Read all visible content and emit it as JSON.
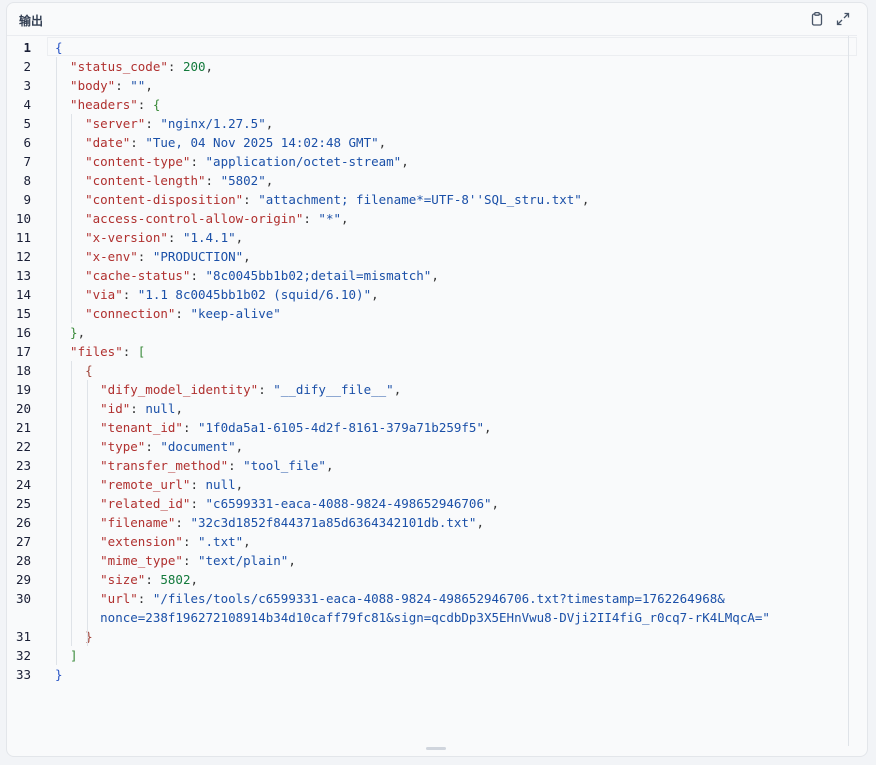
{
  "panel": {
    "title": "输出",
    "copy_icon": "clipboard-icon",
    "expand_icon": "expand-icon"
  },
  "lines": [
    [
      [
        "br1",
        "{"
      ]
    ],
    [
      [
        "key",
        "  \"status_code\""
      ],
      [
        "p",
        ": "
      ],
      [
        "num",
        "200"
      ],
      [
        "p",
        ","
      ]
    ],
    [
      [
        "key",
        "  \"body\""
      ],
      [
        "p",
        ": "
      ],
      [
        "str",
        "\"\""
      ],
      [
        "p",
        ","
      ]
    ],
    [
      [
        "key",
        "  \"headers\""
      ],
      [
        "p",
        ": "
      ],
      [
        "br2",
        "{"
      ]
    ],
    [
      [
        "key",
        "    \"server\""
      ],
      [
        "p",
        ": "
      ],
      [
        "str",
        "\"nginx/1.27.5\""
      ],
      [
        "p",
        ","
      ]
    ],
    [
      [
        "key",
        "    \"date\""
      ],
      [
        "p",
        ": "
      ],
      [
        "str",
        "\"Tue, 04 Nov 2025 14:02:48 GMT\""
      ],
      [
        "p",
        ","
      ]
    ],
    [
      [
        "key",
        "    \"content-type\""
      ],
      [
        "p",
        ": "
      ],
      [
        "str",
        "\"application/octet-stream\""
      ],
      [
        "p",
        ","
      ]
    ],
    [
      [
        "key",
        "    \"content-length\""
      ],
      [
        "p",
        ": "
      ],
      [
        "str",
        "\"5802\""
      ],
      [
        "p",
        ","
      ]
    ],
    [
      [
        "key",
        "    \"content-disposition\""
      ],
      [
        "p",
        ": "
      ],
      [
        "str",
        "\"attachment; filename*=UTF-8''SQL_stru.txt\""
      ],
      [
        "p",
        ","
      ]
    ],
    [
      [
        "key",
        "    \"access-control-allow-origin\""
      ],
      [
        "p",
        ": "
      ],
      [
        "str",
        "\"*\""
      ],
      [
        "p",
        ","
      ]
    ],
    [
      [
        "key",
        "    \"x-version\""
      ],
      [
        "p",
        ": "
      ],
      [
        "str",
        "\"1.4.1\""
      ],
      [
        "p",
        ","
      ]
    ],
    [
      [
        "key",
        "    \"x-env\""
      ],
      [
        "p",
        ": "
      ],
      [
        "str",
        "\"PRODUCTION\""
      ],
      [
        "p",
        ","
      ]
    ],
    [
      [
        "key",
        "    \"cache-status\""
      ],
      [
        "p",
        ": "
      ],
      [
        "str",
        "\"8c0045bb1b02;detail=mismatch\""
      ],
      [
        "p",
        ","
      ]
    ],
    [
      [
        "key",
        "    \"via\""
      ],
      [
        "p",
        ": "
      ],
      [
        "str",
        "\"1.1 8c0045bb1b02 (squid/6.10)\""
      ],
      [
        "p",
        ","
      ]
    ],
    [
      [
        "key",
        "    \"connection\""
      ],
      [
        "p",
        ": "
      ],
      [
        "str",
        "\"keep-alive\""
      ]
    ],
    [
      [
        "br2",
        "  }"
      ],
      [
        "p",
        ","
      ]
    ],
    [
      [
        "key",
        "  \"files\""
      ],
      [
        "p",
        ": "
      ],
      [
        "br2",
        "["
      ]
    ],
    [
      [
        "br3",
        "    {"
      ]
    ],
    [
      [
        "key",
        "      \"dify_model_identity\""
      ],
      [
        "p",
        ": "
      ],
      [
        "str",
        "\"__dify__file__\""
      ],
      [
        "p",
        ","
      ]
    ],
    [
      [
        "key",
        "      \"id\""
      ],
      [
        "p",
        ": "
      ],
      [
        "kw",
        "null"
      ],
      [
        "p",
        ","
      ]
    ],
    [
      [
        "key",
        "      \"tenant_id\""
      ],
      [
        "p",
        ": "
      ],
      [
        "str",
        "\"1f0da5a1-6105-4d2f-8161-379a71b259f5\""
      ],
      [
        "p",
        ","
      ]
    ],
    [
      [
        "key",
        "      \"type\""
      ],
      [
        "p",
        ": "
      ],
      [
        "str",
        "\"document\""
      ],
      [
        "p",
        ","
      ]
    ],
    [
      [
        "key",
        "      \"transfer_method\""
      ],
      [
        "p",
        ": "
      ],
      [
        "str",
        "\"tool_file\""
      ],
      [
        "p",
        ","
      ]
    ],
    [
      [
        "key",
        "      \"remote_url\""
      ],
      [
        "p",
        ": "
      ],
      [
        "kw",
        "null"
      ],
      [
        "p",
        ","
      ]
    ],
    [
      [
        "key",
        "      \"related_id\""
      ],
      [
        "p",
        ": "
      ],
      [
        "str",
        "\"c6599331-eaca-4088-9824-498652946706\""
      ],
      [
        "p",
        ","
      ]
    ],
    [
      [
        "key",
        "      \"filename\""
      ],
      [
        "p",
        ": "
      ],
      [
        "str",
        "\"32c3d1852f844371a85d6364342101db.txt\""
      ],
      [
        "p",
        ","
      ]
    ],
    [
      [
        "key",
        "      \"extension\""
      ],
      [
        "p",
        ": "
      ],
      [
        "str",
        "\".txt\""
      ],
      [
        "p",
        ","
      ]
    ],
    [
      [
        "key",
        "      \"mime_type\""
      ],
      [
        "p",
        ": "
      ],
      [
        "str",
        "\"text/plain\""
      ],
      [
        "p",
        ","
      ]
    ],
    [
      [
        "key",
        "      \"size\""
      ],
      [
        "p",
        ": "
      ],
      [
        "num",
        "5802"
      ],
      [
        "p",
        ","
      ]
    ],
    [
      [
        "key",
        "      \"url\""
      ],
      [
        "p",
        ": "
      ],
      [
        "str",
        "\"/files/tools/c6599331-eaca-4088-9824-498652946706.txt?timestamp=1762264968&"
      ]
    ],
    [
      [
        "br3",
        "    }"
      ]
    ],
    [
      [
        "br2",
        "  ]"
      ]
    ],
    [
      [
        "br1",
        "}"
      ]
    ]
  ],
  "url_continuation": "      nonce=238f196272108914b34d10caff79fc81&sign=qcdbDp3X5EHnVwu8-DVji2II4fiG_r0cq7-rK4LMqcA=\"",
  "line_numbers": [
    "1",
    "2",
    "3",
    "4",
    "5",
    "6",
    "7",
    "8",
    "9",
    "10",
    "11",
    "12",
    "13",
    "14",
    "15",
    "16",
    "17",
    "18",
    "19",
    "20",
    "21",
    "22",
    "23",
    "24",
    "25",
    "26",
    "27",
    "28",
    "29",
    "30",
    "31",
    "32",
    "33"
  ]
}
